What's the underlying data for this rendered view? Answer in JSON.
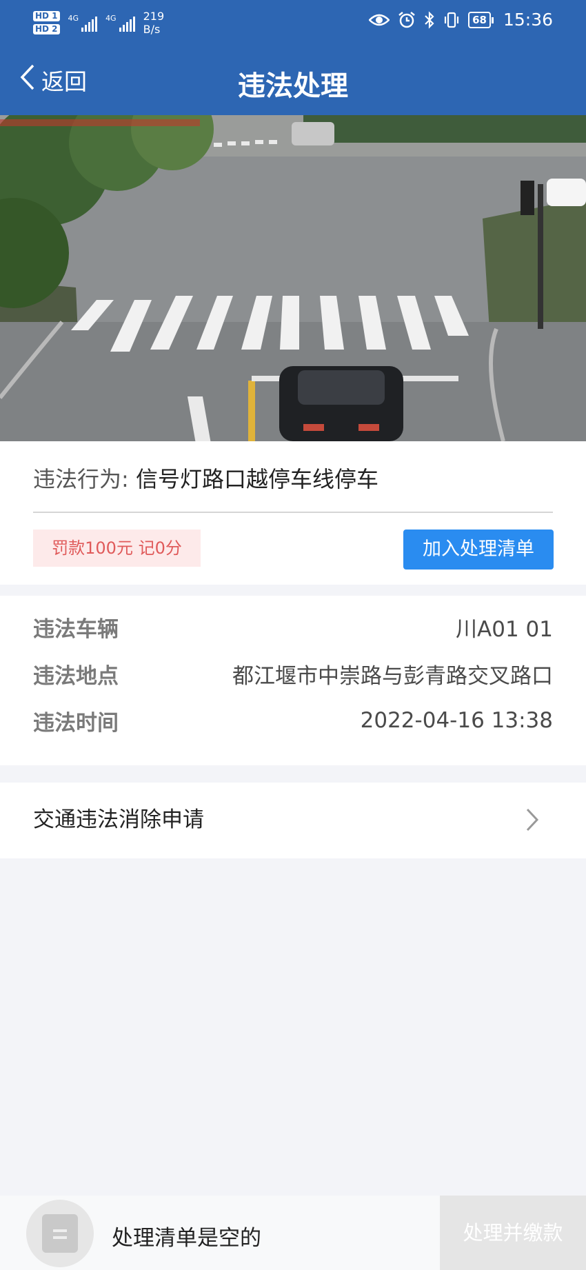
{
  "status_bar": {
    "hd1": "HD 1",
    "hd2": "HD 2",
    "net1": "4G",
    "net2": "4G",
    "speed_value": "219",
    "speed_unit": "B/s",
    "battery": "68",
    "time": "15:36"
  },
  "nav": {
    "back_label": "返回",
    "title": "违法处理"
  },
  "violation": {
    "behavior_label": "违法行为:",
    "behavior_value": "信号灯路口越停车线停车",
    "fine_text": "罚款100元 记0分",
    "add_button": "加入处理清单"
  },
  "details": {
    "rows": [
      {
        "label": "违法车辆",
        "value": "川A01  01"
      },
      {
        "label": "违法地点",
        "value": "都江堰市中崇路与彭青路交叉路口"
      },
      {
        "label": "违法时间",
        "value": "2022-04-16 13:38"
      }
    ]
  },
  "apply": {
    "label": "交通违法消除申请"
  },
  "bottom": {
    "empty_text": "处理清单是空的",
    "pay_button": "处理并缴款"
  },
  "colors": {
    "header_bg": "#2d66b3",
    "primary_button": "#2a8cf0",
    "fine_text": "#e05a5a",
    "fine_bg": "#fdeaea"
  }
}
